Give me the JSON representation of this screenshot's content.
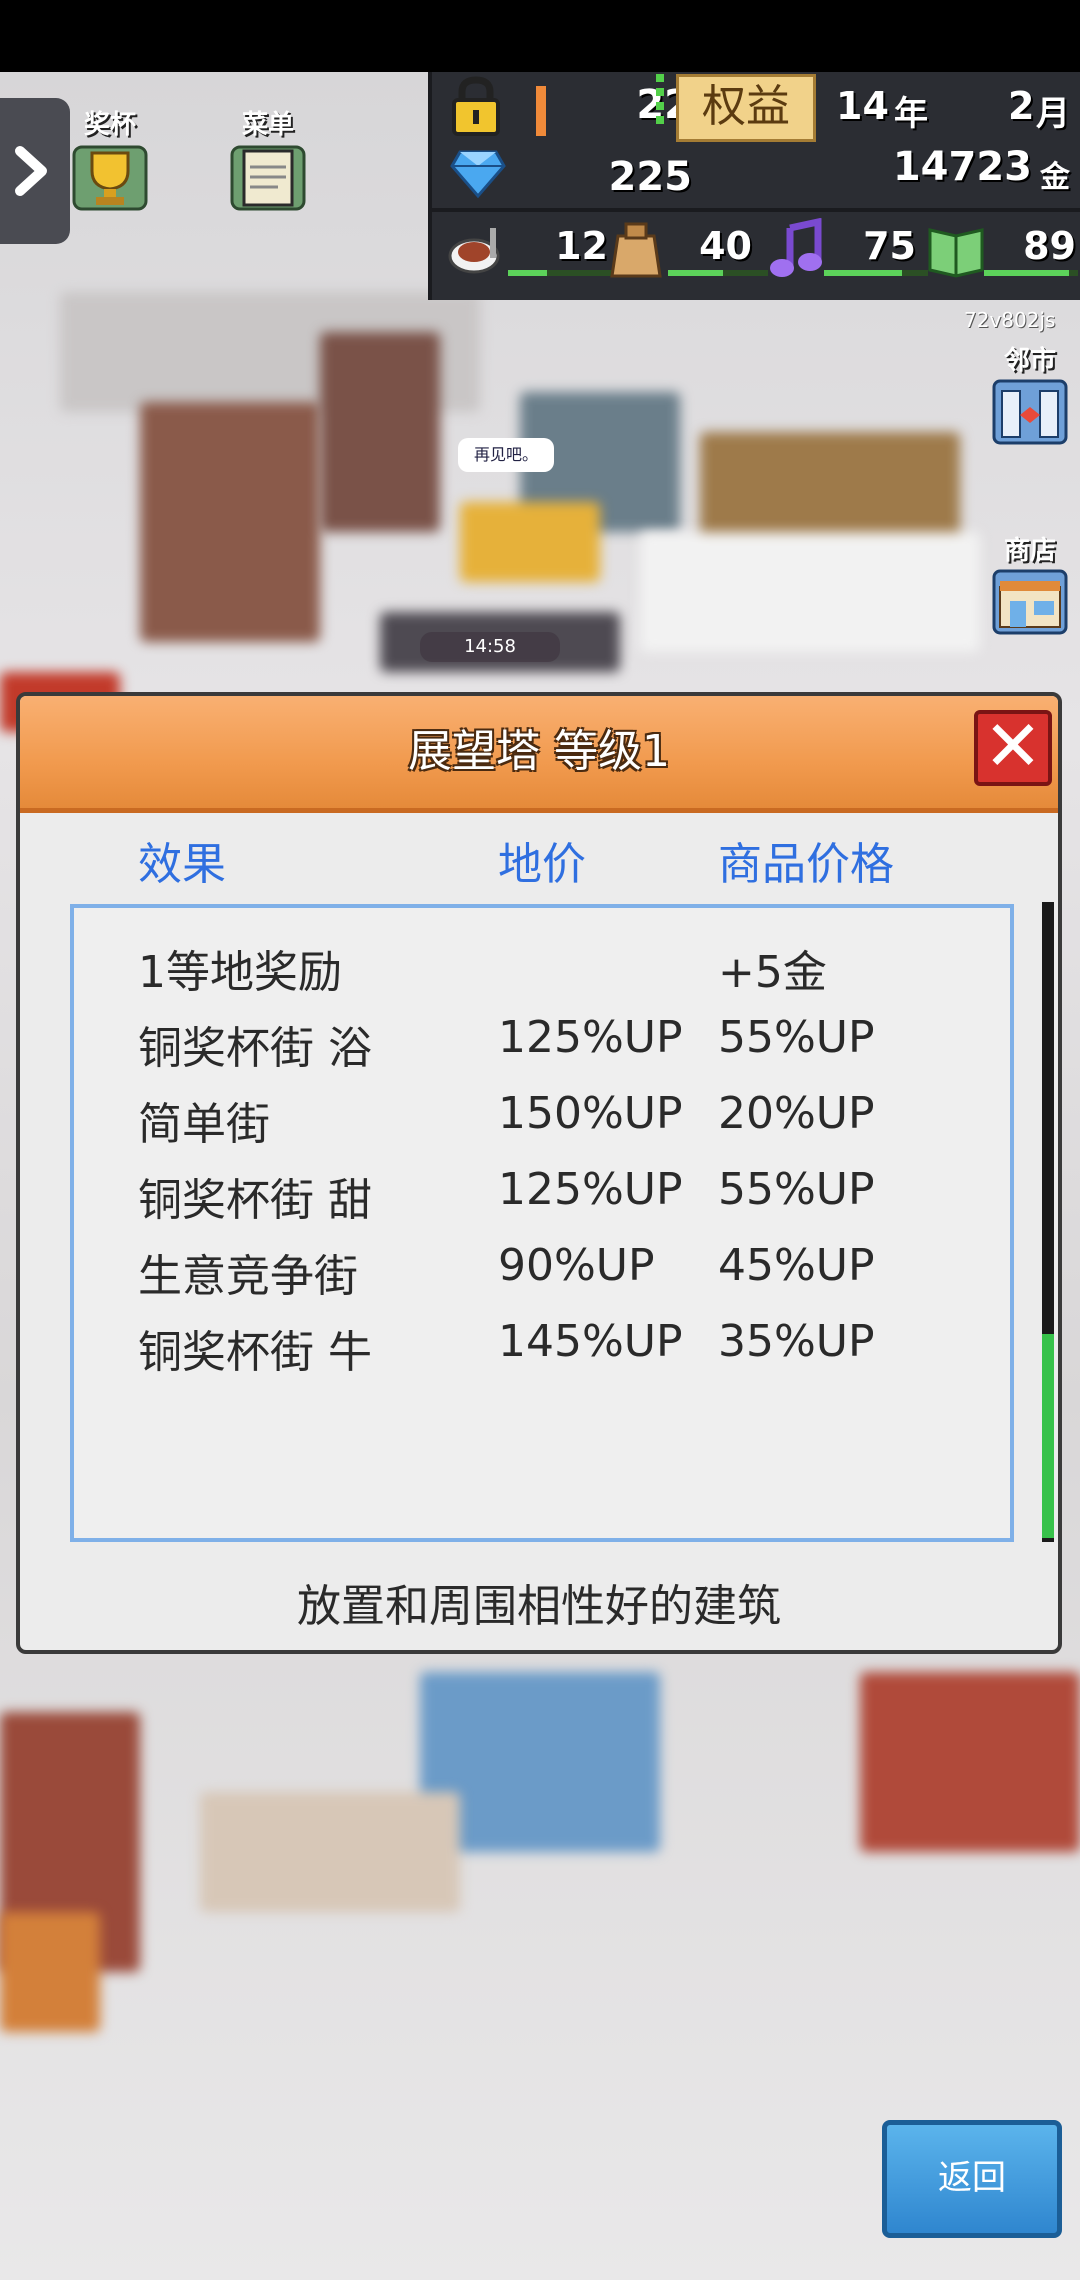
{
  "hud": {
    "lock_level": "22",
    "gems": "225",
    "badge": "权益",
    "year": "14",
    "year_unit": "年",
    "month": "2",
    "month_unit": "月",
    "gold": "14723",
    "gold_unit": "金",
    "stats": [
      {
        "icon": "food-icon",
        "value": "12",
        "level": 0.35
      },
      {
        "icon": "goods-bag-icon",
        "value": "40",
        "level": 0.55
      },
      {
        "icon": "music-note-icon",
        "value": "75",
        "level": 0.75
      },
      {
        "icon": "book-icon",
        "value": "89",
        "level": 0.9
      }
    ],
    "code": "72v802js"
  },
  "left_buttons": {
    "trophy_label": "奖杯",
    "menu_label": "菜单"
  },
  "right_buttons": {
    "neighbor_label": "邻市",
    "shop_label": "商店"
  },
  "map": {
    "speech_bubble": "再见吧。",
    "clock": "14:58"
  },
  "dialog": {
    "title": "展望塔  等级1",
    "columns": [
      "效果",
      "地价",
      "商品价格"
    ],
    "rows": [
      {
        "effect": "1等地奖励",
        "land": "",
        "goods": "+5金"
      },
      {
        "effect": "铜奖杯街 浴",
        "land": "125%UP",
        "goods": "55%UP"
      },
      {
        "effect": "简单街",
        "land": "150%UP",
        "goods": "20%UP"
      },
      {
        "effect": "铜奖杯街 甜",
        "land": "125%UP",
        "goods": "55%UP"
      },
      {
        "effect": "生意竞争街",
        "land": "90%UP",
        "goods": "45%UP"
      },
      {
        "effect": "铜奖杯街 牛",
        "land": "145%UP",
        "goods": "35%UP"
      }
    ],
    "description": "放置和周围相性好的建筑"
  },
  "back_label": "返回",
  "colors": {
    "header_orange": "#f19a4e",
    "column_blue": "#2f6fe0",
    "close_red": "#d8322e",
    "back_blue": "#2f86cf",
    "scroll_green": "#37c24a"
  }
}
